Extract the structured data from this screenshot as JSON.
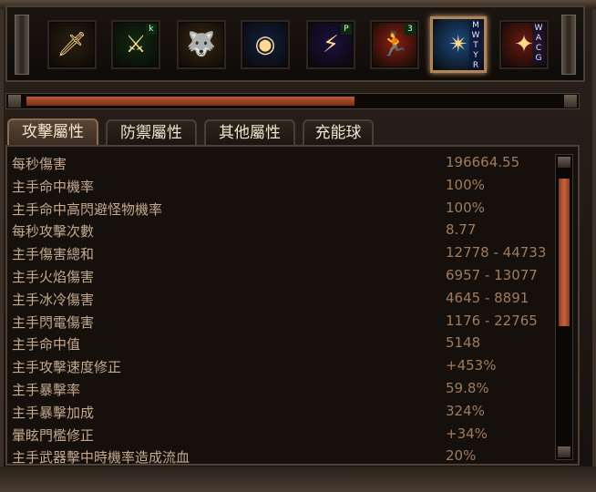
{
  "skills": [
    {
      "name": "sword-skill-icon",
      "glyph": "🗡",
      "bg": "#2a2010",
      "badge": ""
    },
    {
      "name": "poison-blade-skill-icon",
      "glyph": "⚔",
      "bg": "#0f2a10",
      "badge": "k"
    },
    {
      "name": "beast-skill-icon",
      "glyph": "🐺",
      "bg": "#3a2a10",
      "badge": ""
    },
    {
      "name": "ring-orb-skill-icon",
      "glyph": "◉",
      "bg": "#102040",
      "badge": ""
    },
    {
      "name": "lightning-wing-skill-icon",
      "glyph": "⚡",
      "bg": "#1a1040",
      "badge": "P"
    },
    {
      "name": "sprint-skill-icon",
      "glyph": "🏃",
      "bg": "#8a2010",
      "badge": "3"
    },
    {
      "name": "storm-warrior-skill-icon",
      "glyph": "✴",
      "bg": "#1a4a80",
      "letters": [
        "M",
        "W",
        "T",
        "Y",
        "R"
      ]
    },
    {
      "name": "war-cry-skill-icon",
      "glyph": "✦",
      "bg": "#6a1a10",
      "letters": [
        "W",
        "A",
        "C",
        "G"
      ]
    }
  ],
  "progress": {
    "value": 0.6
  },
  "tabs": [
    "攻擊屬性",
    "防禦屬性",
    "其他屬性",
    "充能球"
  ],
  "active_tab": 0,
  "stats": [
    {
      "label": "每秒傷害",
      "value": "196664.55"
    },
    {
      "label": "主手命中機率",
      "value": "100%"
    },
    {
      "label": "主手命中高閃避怪物機率",
      "value": "100%"
    },
    {
      "label": "每秒攻擊次數",
      "value": "8.77"
    },
    {
      "label": "主手傷害總和",
      "value": "12778 - 44733"
    },
    {
      "label": "主手火焰傷害",
      "value": "6957 - 13077"
    },
    {
      "label": "主手冰冷傷害",
      "value": "4645 - 8891"
    },
    {
      "label": "主手閃電傷害",
      "value": "1176 - 22765"
    },
    {
      "label": "主手命中值",
      "value": "5148"
    },
    {
      "label": "主手攻擊速度修正",
      "value": "+453%"
    },
    {
      "label": "主手暴擊率",
      "value": "59.8%"
    },
    {
      "label": "主手暴擊加成",
      "value": "324%"
    },
    {
      "label": "暈眩門檻修正",
      "value": "+34%"
    },
    {
      "label": "主手武器擊中時機率造成流血",
      "value": "20%"
    }
  ]
}
